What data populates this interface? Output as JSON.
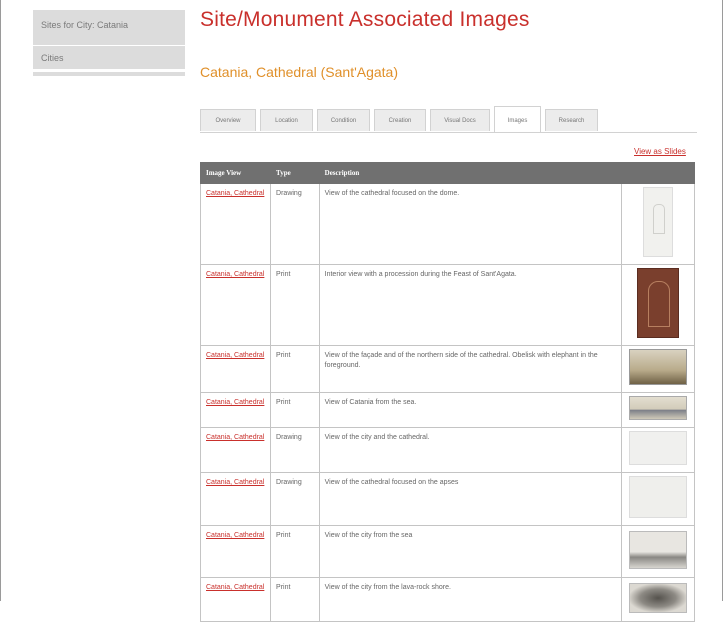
{
  "sidebar": {
    "items": [
      {
        "label": "Sites for City: Catania"
      },
      {
        "label": "Cities"
      }
    ]
  },
  "page_title": "Site/Monument Associated Images",
  "site_title": "Catania, Cathedral (Sant'Agata)",
  "tabs": [
    {
      "label": "Overview",
      "active": false
    },
    {
      "label": "Location",
      "active": false
    },
    {
      "label": "Condition",
      "active": false
    },
    {
      "label": "Creation",
      "active": false
    },
    {
      "label": "Visual Docs",
      "active": false
    },
    {
      "label": "Images",
      "active": true
    },
    {
      "label": "Research",
      "active": false
    }
  ],
  "view_as_slides": "View as Slides",
  "table": {
    "headers": [
      "Image View",
      "Type",
      "Description",
      ""
    ],
    "rows": [
      {
        "link": "Catania, Cathedral",
        "type": "Drawing",
        "description": "View of the cathedral focused on the dome."
      },
      {
        "link": "Catania, Cathedral",
        "type": "Print",
        "description": "Interior view with a procession during the Feast of Sant'Agata."
      },
      {
        "link": "Catania, Cathedral",
        "type": "Print",
        "description": "View of the façade and of the northern side of the cathedral. Obelisk with elephant in the foreground."
      },
      {
        "link": "Catania, Cathedral",
        "type": "Print",
        "description": "View of Catania from the sea."
      },
      {
        "link": "Catania, Cathedral",
        "type": "Drawing",
        "description": "View of the city and the cathedral."
      },
      {
        "link": "Catania, Cathedral",
        "type": "Drawing",
        "description": "View of the cathedral focused on the apses"
      },
      {
        "link": "Catania, Cathedral",
        "type": "Print",
        "description": "View of the city from the sea"
      },
      {
        "link": "Catania, Cathedral",
        "type": "Print",
        "description": "View of the city from the lava-rock shore."
      }
    ]
  },
  "colors": {
    "title_red": "#c9302c",
    "subtitle_orange": "#e0902a",
    "header_gray": "#707070",
    "sidebar_gray": "#dcdcdc"
  }
}
